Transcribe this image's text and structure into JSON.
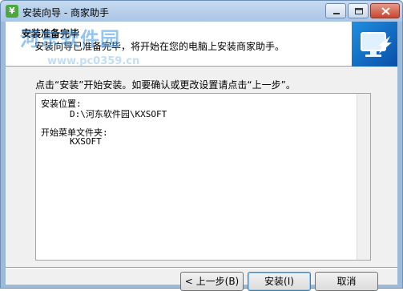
{
  "window": {
    "title": "安装向导 - 商家助手",
    "icon_glyph": "¥"
  },
  "header": {
    "title": "安装准备完毕",
    "subtitle": "安装向导已准备完毕，将开始在您的电脑上安装商家助手。"
  },
  "watermark": {
    "text": "河东软件园",
    "url": "www.pc0359.cn"
  },
  "main": {
    "instruction": "点击“安装”开始安装。如要确认或更改设置请点击“上一步”。",
    "memo": {
      "install_location_label": "安装位置:",
      "install_location_value": "D:\\河东软件园\\KXSOFT",
      "start_menu_label": "开始菜单文件夹:",
      "start_menu_value": "KXSOFT"
    }
  },
  "buttons": {
    "back": "< 上一步(B)",
    "install": "安装(I)",
    "cancel": "取消"
  },
  "colors": {
    "accent": "#3c7fb1",
    "titlebar": "#a9c5e6",
    "close": "#c64630"
  }
}
